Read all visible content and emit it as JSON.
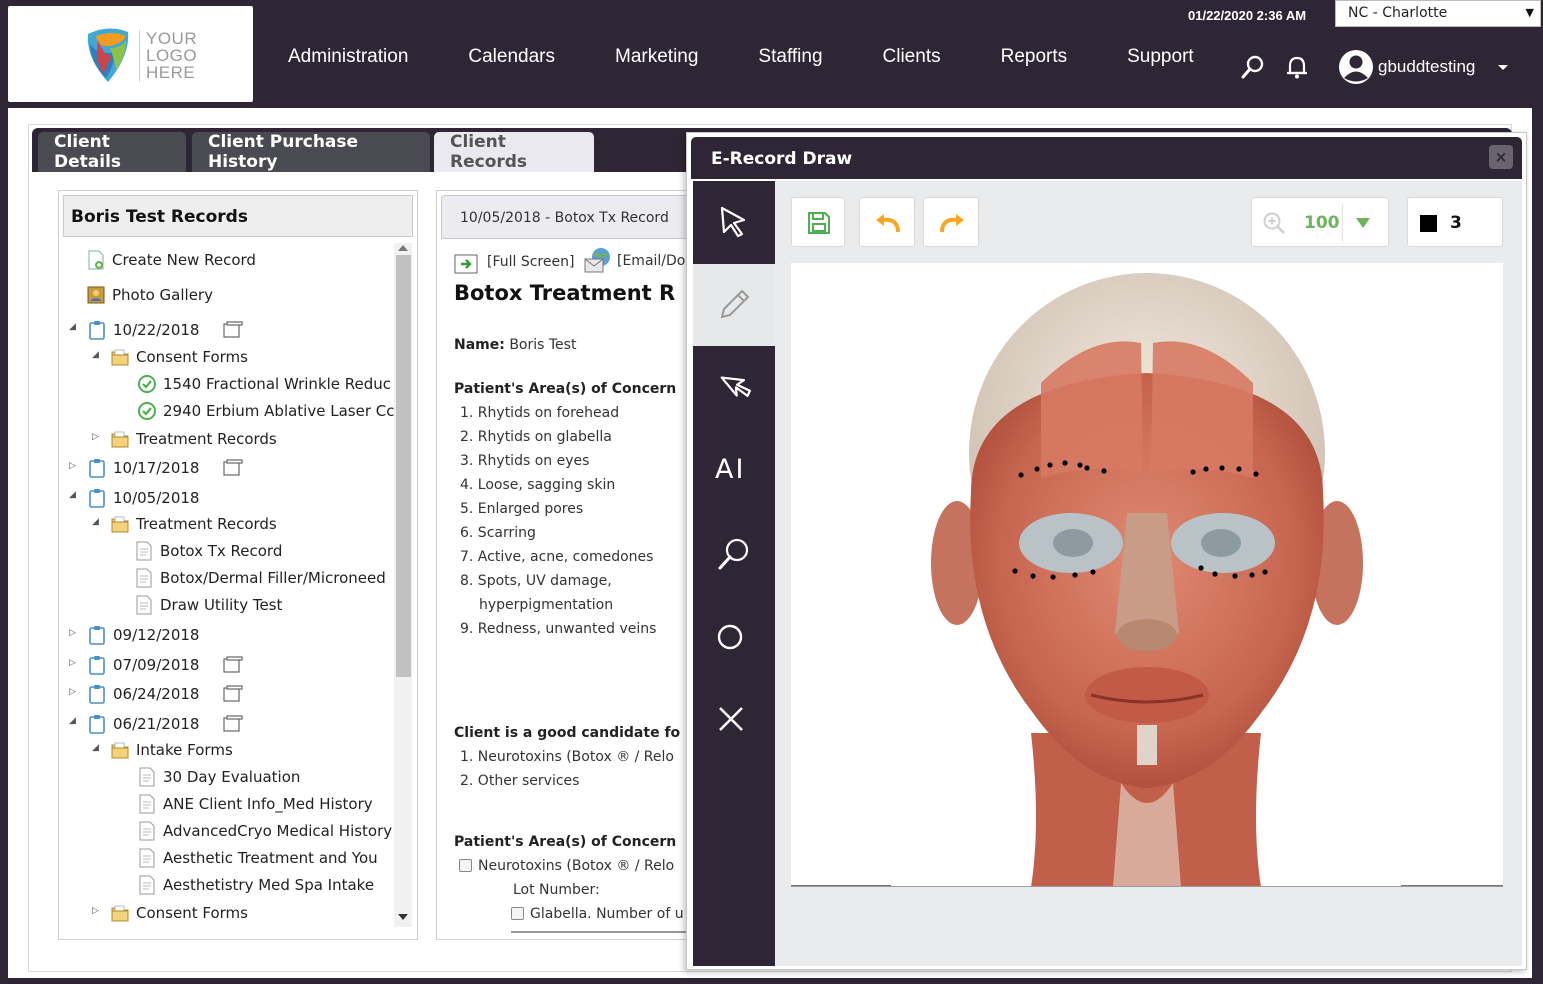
{
  "header": {
    "logo_text": "YOUR LOGO HERE",
    "nav": [
      "Administration",
      "Calendars",
      "Marketing",
      "Staffing",
      "Clients",
      "Reports",
      "Support"
    ],
    "datetime": "01/22/2020 2:36 AM",
    "location": "NC - Charlotte",
    "username": "gbuddtesting",
    "icons": [
      "search-icon",
      "bell-icon",
      "user-avatar-icon",
      "chevron-down-icon"
    ]
  },
  "tabs": [
    "Client Details",
    "Client Purchase History",
    "Client Records"
  ],
  "active_tab": "Client Records",
  "tree": {
    "title": "Boris Test Records",
    "items": [
      {
        "label": "Create New Record"
      },
      {
        "label": "Photo Gallery"
      },
      {
        "label": "10/22/2018"
      },
      {
        "label": "Consent Forms"
      },
      {
        "label": "1540 Fractional Wrinkle Reduc"
      },
      {
        "label": "2940 Erbium Ablative Laser Cc"
      },
      {
        "label": "Treatment Records"
      },
      {
        "label": "10/17/2018"
      },
      {
        "label": "10/05/2018"
      },
      {
        "label": "Treatment Records"
      },
      {
        "label": "Botox Tx Record"
      },
      {
        "label": "Botox/Dermal Filler/Microneed"
      },
      {
        "label": "Draw Utility Test"
      },
      {
        "label": "09/12/2018"
      },
      {
        "label": "07/09/2018"
      },
      {
        "label": "06/24/2018"
      },
      {
        "label": "06/21/2018"
      },
      {
        "label": "Intake Forms"
      },
      {
        "label": "30 Day Evaluation"
      },
      {
        "label": "ANE Client Info_Med History"
      },
      {
        "label": "AdvancedCryo Medical History"
      },
      {
        "label": "Aesthetic Treatment and You"
      },
      {
        "label": "Aesthetistry Med Spa Intake"
      },
      {
        "label": "Consent Forms"
      }
    ]
  },
  "record": {
    "header": "10/05/2018 - Botox Tx Record",
    "full_screen": "[Full Screen]",
    "email": "[Email/Dov",
    "title": "Botox Treatment R",
    "name_label": "Name:",
    "name_value": "Boris Test",
    "concern_heading": "Patient's Area(s) of Concern",
    "concerns": [
      "1. Rhytids on forehead",
      "2. Rhytids on glabella",
      "3. Rhytids on eyes",
      "4. Loose, sagging skin",
      "5. Enlarged pores",
      "6. Scarring",
      "7. Active, acne, comedones",
      "8. Spots, UV damage,",
      "hyperpigmentation",
      "9. Redness, unwanted veins"
    ],
    "candidate_heading": "Client is a good candidate fo",
    "candidates": [
      "1. Neurotoxins (Botox ® / Relo",
      "2. Other services"
    ],
    "concern_heading2": "Patient's Area(s) of Concern",
    "check1": "Neurotoxins (Botox ® / Relo",
    "lot_number": "Lot Number:",
    "check2": "Glabella. Number of u"
  },
  "modal": {
    "title": "E-Record Draw",
    "close": "×",
    "tools": [
      "pointer-tool",
      "pencil-tool",
      "eraser-cursor-tool",
      "text-tool",
      "zoom-tool",
      "circle-tool",
      "close-tool"
    ],
    "text_tool_label": "AI",
    "zoom": "100",
    "brush_size": "3",
    "brush_color": "#000000",
    "accent_green": "#6cb55a",
    "accent_orange": "#f5a623"
  }
}
